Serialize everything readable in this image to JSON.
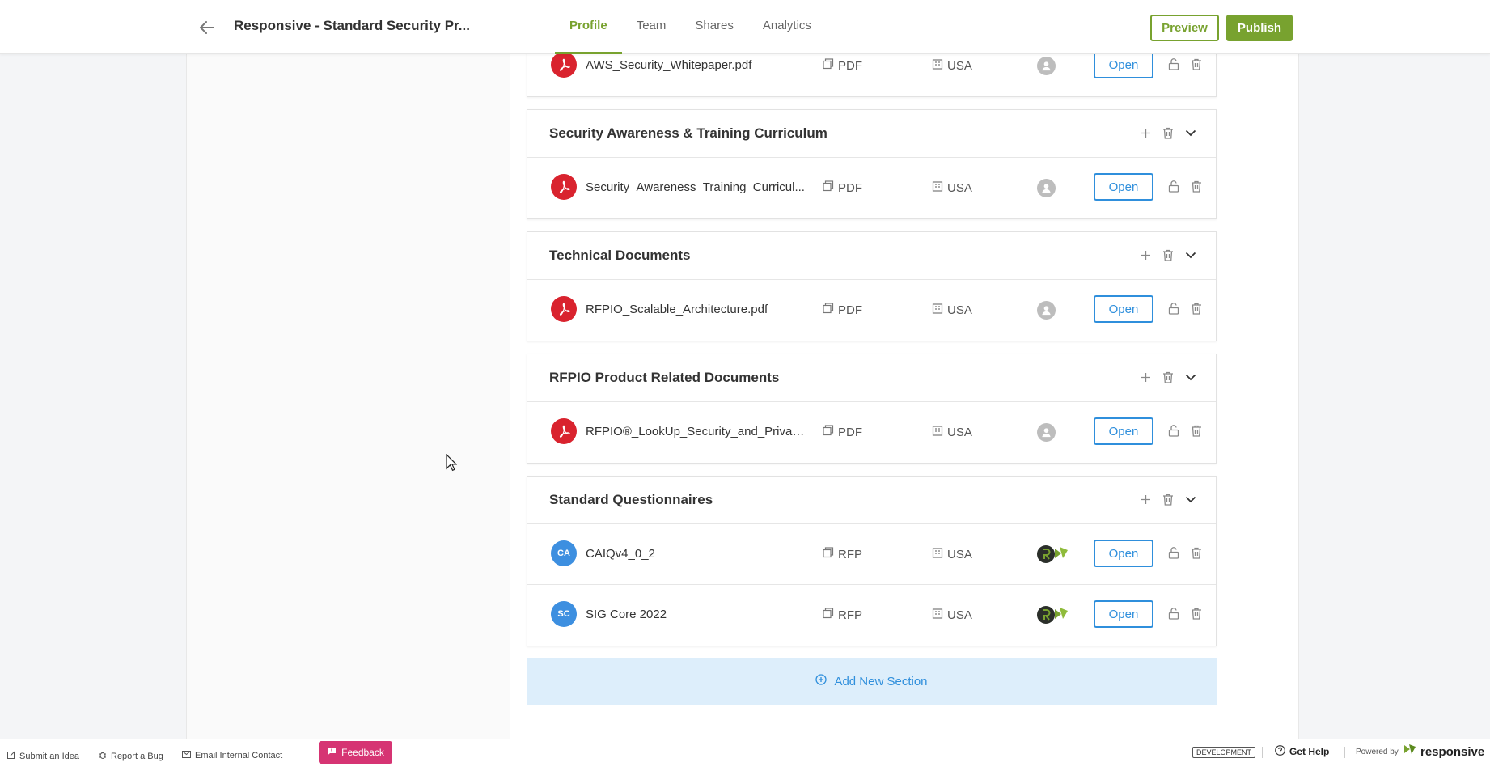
{
  "header": {
    "title": "Responsive - Standard Security Pr...",
    "tabs": [
      {
        "label": "Profile",
        "active": true
      },
      {
        "label": "Team",
        "active": false
      },
      {
        "label": "Shares",
        "active": false
      },
      {
        "label": "Analytics",
        "active": false
      }
    ],
    "preview_label": "Preview",
    "publish_label": "Publish"
  },
  "sections": [
    {
      "title": "",
      "rows": [
        {
          "icon": "pdf",
          "name": "AWS_Security_Whitepaper.pdf",
          "type": "PDF",
          "region": "USA",
          "owner": "default-avatar",
          "open_label": "Open"
        }
      ]
    },
    {
      "title": "Security Awareness & Training Curriculum",
      "rows": [
        {
          "icon": "pdf",
          "name": "Security_Awareness_Training_Curricul...",
          "type": "PDF",
          "region": "USA",
          "owner": "default-avatar",
          "open_label": "Open"
        }
      ]
    },
    {
      "title": "Technical Documents",
      "rows": [
        {
          "icon": "pdf",
          "name": "RFPIO_Scalable_Architecture.pdf",
          "type": "PDF",
          "region": "USA",
          "owner": "default-avatar",
          "open_label": "Open"
        }
      ]
    },
    {
      "title": "RFPIO Product Related Documents",
      "rows": [
        {
          "icon": "pdf",
          "name": "RFPIO®_LookUp_Security_and_Privacy...",
          "type": "PDF",
          "region": "USA",
          "owner": "default-avatar",
          "open_label": "Open"
        }
      ]
    },
    {
      "title": "Standard Questionnaires",
      "rows": [
        {
          "icon": "CA",
          "name": "CAIQv4_0_2",
          "type": "RFP",
          "region": "USA",
          "owner": "responsive-logo",
          "open_label": "Open"
        },
        {
          "icon": "SC",
          "name": "SIG Core 2022",
          "type": "RFP",
          "region": "USA",
          "owner": "responsive-logo",
          "open_label": "Open"
        }
      ]
    }
  ],
  "add_section_label": "Add New Section",
  "footer": {
    "submit_idea": "Submit an Idea",
    "report_bug": "Report a Bug",
    "email_contact": "Email Internal Contact",
    "feedback": "Feedback",
    "environment": "DEVELOPMENT",
    "get_help": "Get Help",
    "powered_by": "Powered by",
    "brand": "responsive"
  },
  "colors": {
    "brand_green": "#78a22f",
    "link_blue": "#2f8fdc",
    "pdf_red": "#d9232e",
    "feedback_pink": "#d63473"
  }
}
